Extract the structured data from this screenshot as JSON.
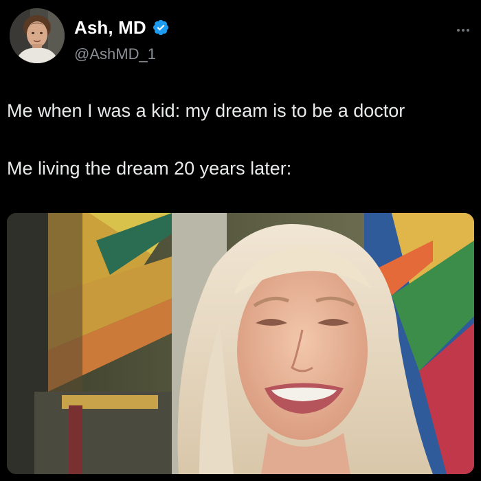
{
  "author": {
    "name": "Ash, MD",
    "handle": "@AshMD_1",
    "verified": true,
    "avatar_icon": "profile-photo-avatar",
    "verified_icon": "verified-badge-icon",
    "verified_color": "#1d9bf0"
  },
  "menu": {
    "icon": "more-options-icon"
  },
  "post": {
    "line1": "Me when I was a kid: my dream is to be a doctor",
    "line2": "Me living the dream 20 years later:"
  },
  "media": {
    "icon": "meme-photo-crying-woman"
  },
  "colors": {
    "background": "#000000",
    "text": "#e7e9ea",
    "secondary_text": "#8b9096"
  }
}
